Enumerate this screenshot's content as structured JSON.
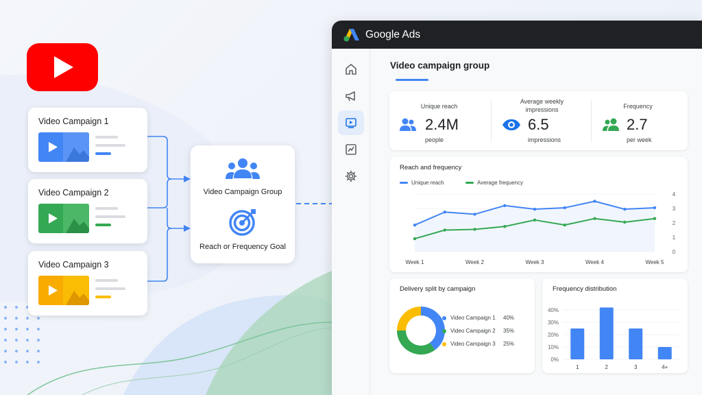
{
  "colors": {
    "youtube_red": "#ff0000",
    "google_blue": "#4285f4",
    "google_green": "#34a853",
    "google_yellow": "#fbbc04",
    "header_dark": "#202124"
  },
  "campaigns": [
    {
      "label": "Video Campaign 1",
      "color": "#4285f4"
    },
    {
      "label": "Video Campaign 2",
      "color": "#34a853"
    },
    {
      "label": "Video Campaign 3",
      "color": "#fbbc04"
    }
  ],
  "group": {
    "label": "Video Campaign Group",
    "goal_label": "Reach or Frequency Goal",
    "group_icon": "people-icon",
    "goal_icon": "target-icon"
  },
  "ads": {
    "app_title": "Google Ads",
    "page_title": "Video campaign group",
    "nav": [
      {
        "icon": "home-icon"
      },
      {
        "icon": "megaphone-icon"
      },
      {
        "icon": "video-icon",
        "active": true
      },
      {
        "icon": "reports-icon"
      },
      {
        "icon": "gear-icon"
      }
    ],
    "metrics": [
      {
        "label": "Unique reach",
        "value": "2.4M",
        "sub": "people",
        "icon": "people-icon"
      },
      {
        "label": "Average weekly impressions",
        "value": "6.5",
        "sub": "impressions",
        "icon": "eye-icon"
      },
      {
        "label": "Frequency",
        "value": "2.7",
        "sub": "per week",
        "icon": "people-icon"
      }
    ],
    "reach_chart_title": "Reach and frequency",
    "delivery_title": "Delivery split by campaign",
    "freq_dist_title": "Frequency distribution"
  },
  "chart_data": [
    {
      "type": "line",
      "title": "Reach and frequency",
      "x": [
        "Week 1",
        "",
        "",
        "",
        "",
        "Week 2",
        "",
        "",
        "",
        "",
        "Week 3",
        "",
        "",
        "",
        "",
        "Week 4",
        "",
        "",
        "",
        "",
        "Week 5"
      ],
      "x_ticks": [
        "Week 1",
        "Week 2",
        "Week 3",
        "Week 4",
        "Week 5"
      ],
      "y_ticks": [
        0,
        1,
        2,
        3,
        4
      ],
      "ylim": [
        0,
        4
      ],
      "series": [
        {
          "name": "Unique reach",
          "color": "#4285f4",
          "values": [
            1.85,
            2.75,
            2.6,
            3.2,
            2.95,
            3.05,
            3.5,
            2.95,
            3.05
          ]
        },
        {
          "name": "Average frequency",
          "color": "#34a853",
          "values": [
            0.9,
            1.5,
            1.55,
            1.75,
            2.2,
            1.85,
            2.3,
            2.05,
            2.3
          ]
        }
      ]
    },
    {
      "type": "pie",
      "title": "Delivery split by campaign",
      "slices": [
        {
          "label": "Video Campaign 1",
          "value": 40,
          "display": "40%",
          "color": "#4285f4"
        },
        {
          "label": "Video Campaign 2",
          "value": 35,
          "display": "35%",
          "color": "#34a853"
        },
        {
          "label": "Video Campaign 3",
          "value": 25,
          "display": "25%",
          "color": "#fbbc04"
        }
      ]
    },
    {
      "type": "bar",
      "title": "Frequency distribution",
      "categories": [
        "1",
        "2",
        "3",
        "4+"
      ],
      "values": [
        25,
        42,
        25,
        10
      ],
      "y_ticks": [
        "0%",
        "10%",
        "20%",
        "30%",
        "40%"
      ],
      "ylim": [
        0,
        40
      ],
      "color": "#4285f4"
    }
  ]
}
